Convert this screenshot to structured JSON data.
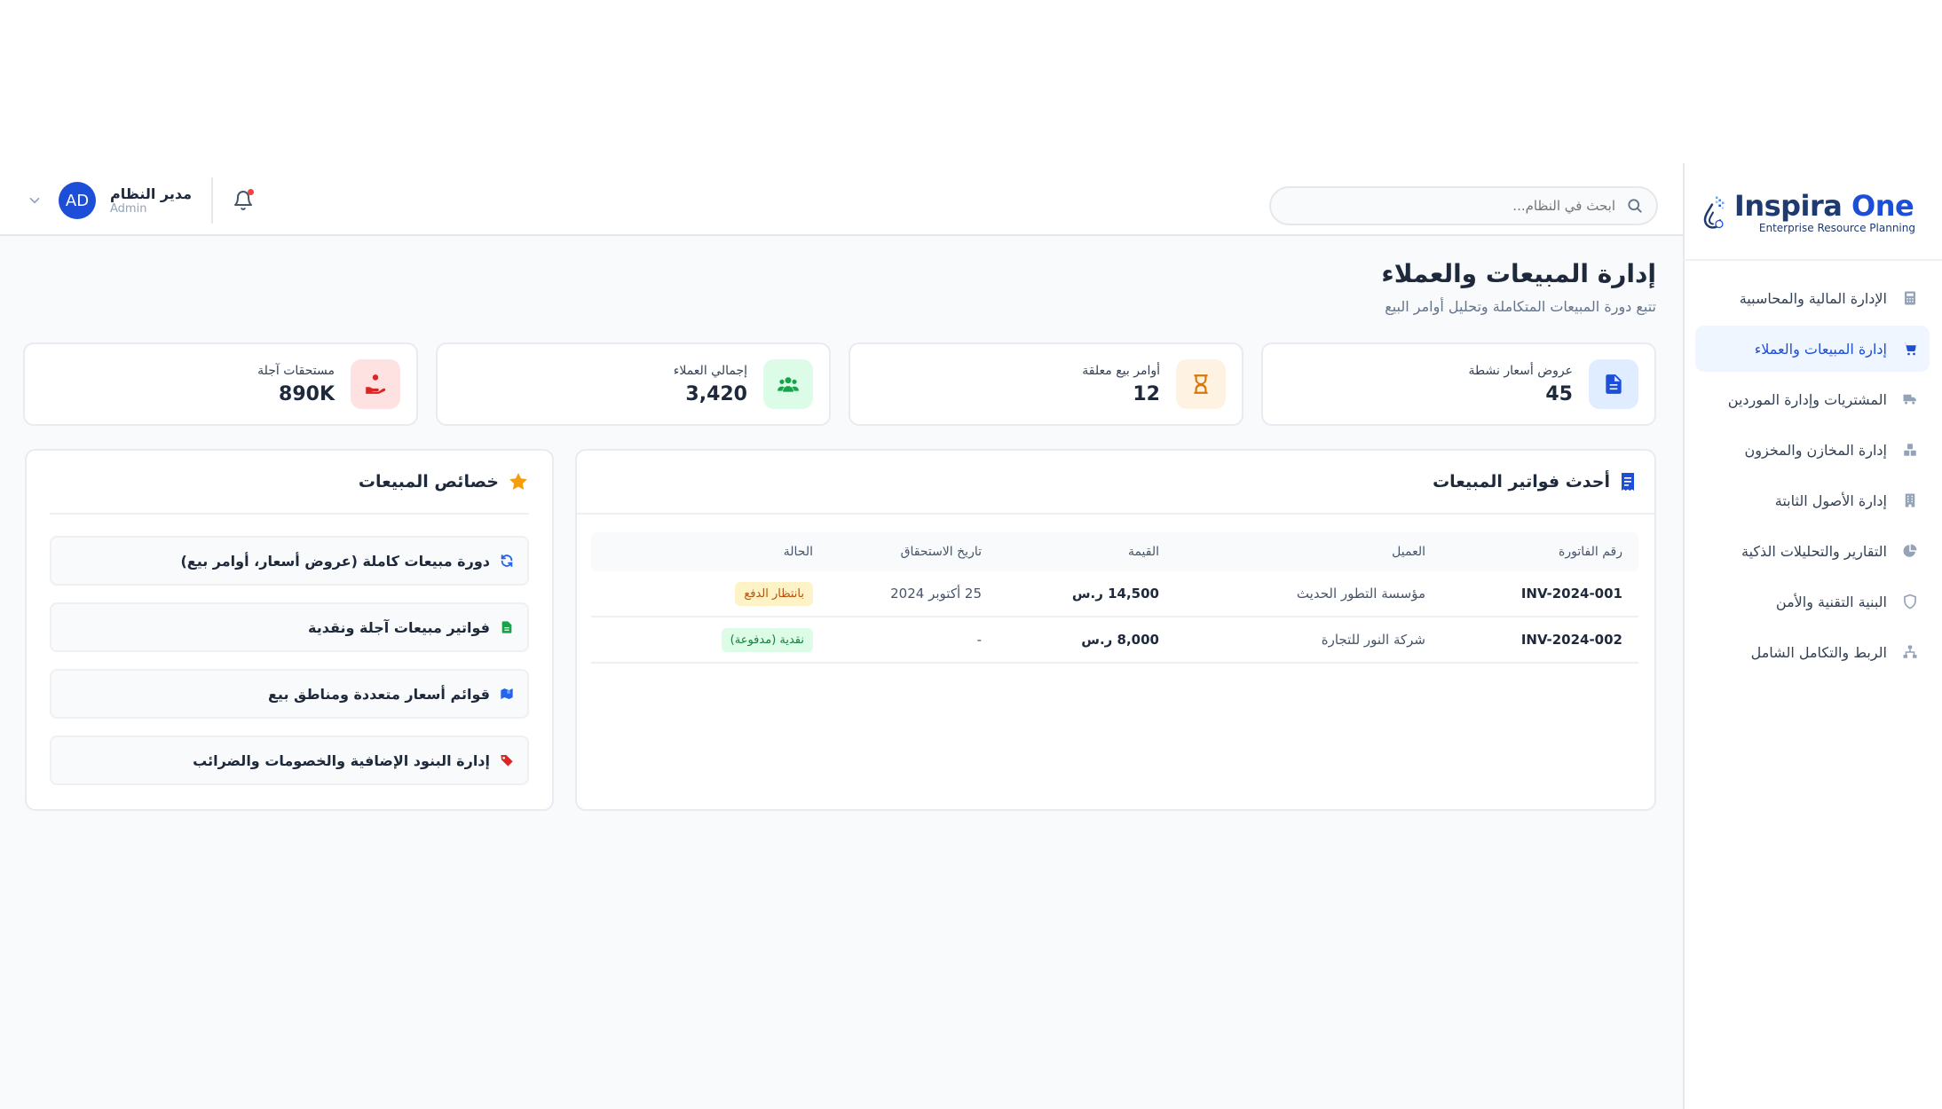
{
  "brand": {
    "name_part1": "Inspira",
    "name_part2": " One",
    "tagline": "Enterprise Resource Planning"
  },
  "sidebar": {
    "items": [
      {
        "label": "الإدارة المالية والمحاسبية",
        "icon": "calculator-icon",
        "active": false
      },
      {
        "label": "إدارة المبيعات والعملاء",
        "icon": "shopping-cart-icon",
        "active": true
      },
      {
        "label": "المشتريات وإدارة الموردين",
        "icon": "truck-icon",
        "active": false
      },
      {
        "label": "إدارة المخازن والمخزون",
        "icon": "boxes-icon",
        "active": false
      },
      {
        "label": "إدارة الأصول الثابتة",
        "icon": "building-icon",
        "active": false
      },
      {
        "label": "التقارير والتحليلات الذكية",
        "icon": "pie-chart-icon",
        "active": false
      },
      {
        "label": "البنية التقنية والأمن",
        "icon": "shield-icon",
        "active": false
      },
      {
        "label": "الربط والتكامل الشامل",
        "icon": "network-icon",
        "active": false
      }
    ]
  },
  "header": {
    "search_placeholder": "ابحث في النظام...",
    "user_name": "مدير النظام",
    "user_role": "Admin",
    "avatar_initials": "AD"
  },
  "page": {
    "title": "إدارة المبيعات والعملاء",
    "subtitle": "تتبع دورة المبيعات المتكاملة وتحليل أوامر البيع"
  },
  "stats": [
    {
      "label": "عروض أسعار نشطة",
      "value": "45",
      "icon": "file-icon",
      "bg": "#e0ecff",
      "color": "#1d4ed8"
    },
    {
      "label": "أوامر بيع معلقة",
      "value": "12",
      "icon": "hourglass-icon",
      "bg": "#fef3e2",
      "color": "#d97706"
    },
    {
      "label": "إجمالي العملاء",
      "value": "3,420",
      "icon": "users-icon",
      "bg": "#dcfce7",
      "color": "#16a34a"
    },
    {
      "label": "مستحقات آجلة",
      "value": "890K",
      "icon": "hand-coin-icon",
      "bg": "#fee2e2",
      "color": "#dc2626"
    }
  ],
  "invoices": {
    "title": "أحدث فواتير المبيعات",
    "columns": [
      "رقم الفاتورة",
      "العميل",
      "القيمة",
      "تاريخ الاستحقاق",
      "الحالة"
    ],
    "rows": [
      {
        "number": "INV-2024-001",
        "client": "مؤسسة التطور الحديث",
        "amount": "14,500 ر.س",
        "due": "25 أكتوبر 2024",
        "status": "بانتظار الدفع",
        "status_type": "pending"
      },
      {
        "number": "INV-2024-002",
        "client": "شركة النور للتجارة",
        "amount": "8,000 ر.س",
        "due": "-",
        "status": "نقدية (مدفوعة)",
        "status_type": "paid"
      }
    ]
  },
  "features": {
    "title": "خصائص المبيعات",
    "items": [
      {
        "label": "دورة مبيعات كاملة (عروض أسعار، أوامر بيع)",
        "icon": "refresh-icon"
      },
      {
        "label": "فواتير مبيعات آجلة ونقدية",
        "icon": "invoice-icon"
      },
      {
        "label": "قوائم أسعار متعددة ومناطق بيع",
        "icon": "map-icon"
      },
      {
        "label": "إدارة البنود الإضافية والخصومات والضرائب",
        "icon": "tags-icon"
      }
    ]
  }
}
